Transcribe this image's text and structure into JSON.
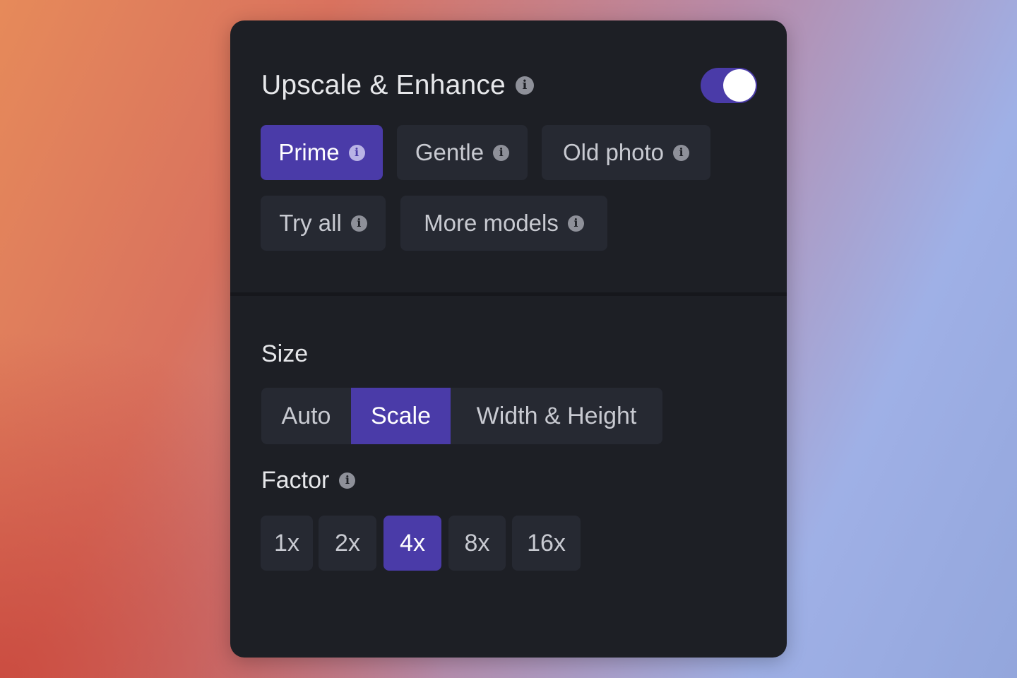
{
  "panel": {
    "title": "Upscale & Enhance",
    "enabled": true
  },
  "models": {
    "items": [
      {
        "label": "Prime",
        "active": true
      },
      {
        "label": "Gentle",
        "active": false
      },
      {
        "label": "Old photo",
        "active": false
      },
      {
        "label": "Try all",
        "active": false
      },
      {
        "label": "More models",
        "active": false
      }
    ]
  },
  "size": {
    "label": "Size",
    "options": [
      "Auto",
      "Scale",
      "Width & Height"
    ],
    "selected": "Scale"
  },
  "factor": {
    "label": "Factor",
    "options": [
      "1x",
      "2x",
      "4x",
      "8x",
      "16x"
    ],
    "selected": "4x"
  },
  "colors": {
    "accent": "#4a3ba8",
    "panel": "#1d1f25",
    "chip": "#262932"
  },
  "icons": {
    "info": "info-icon"
  }
}
